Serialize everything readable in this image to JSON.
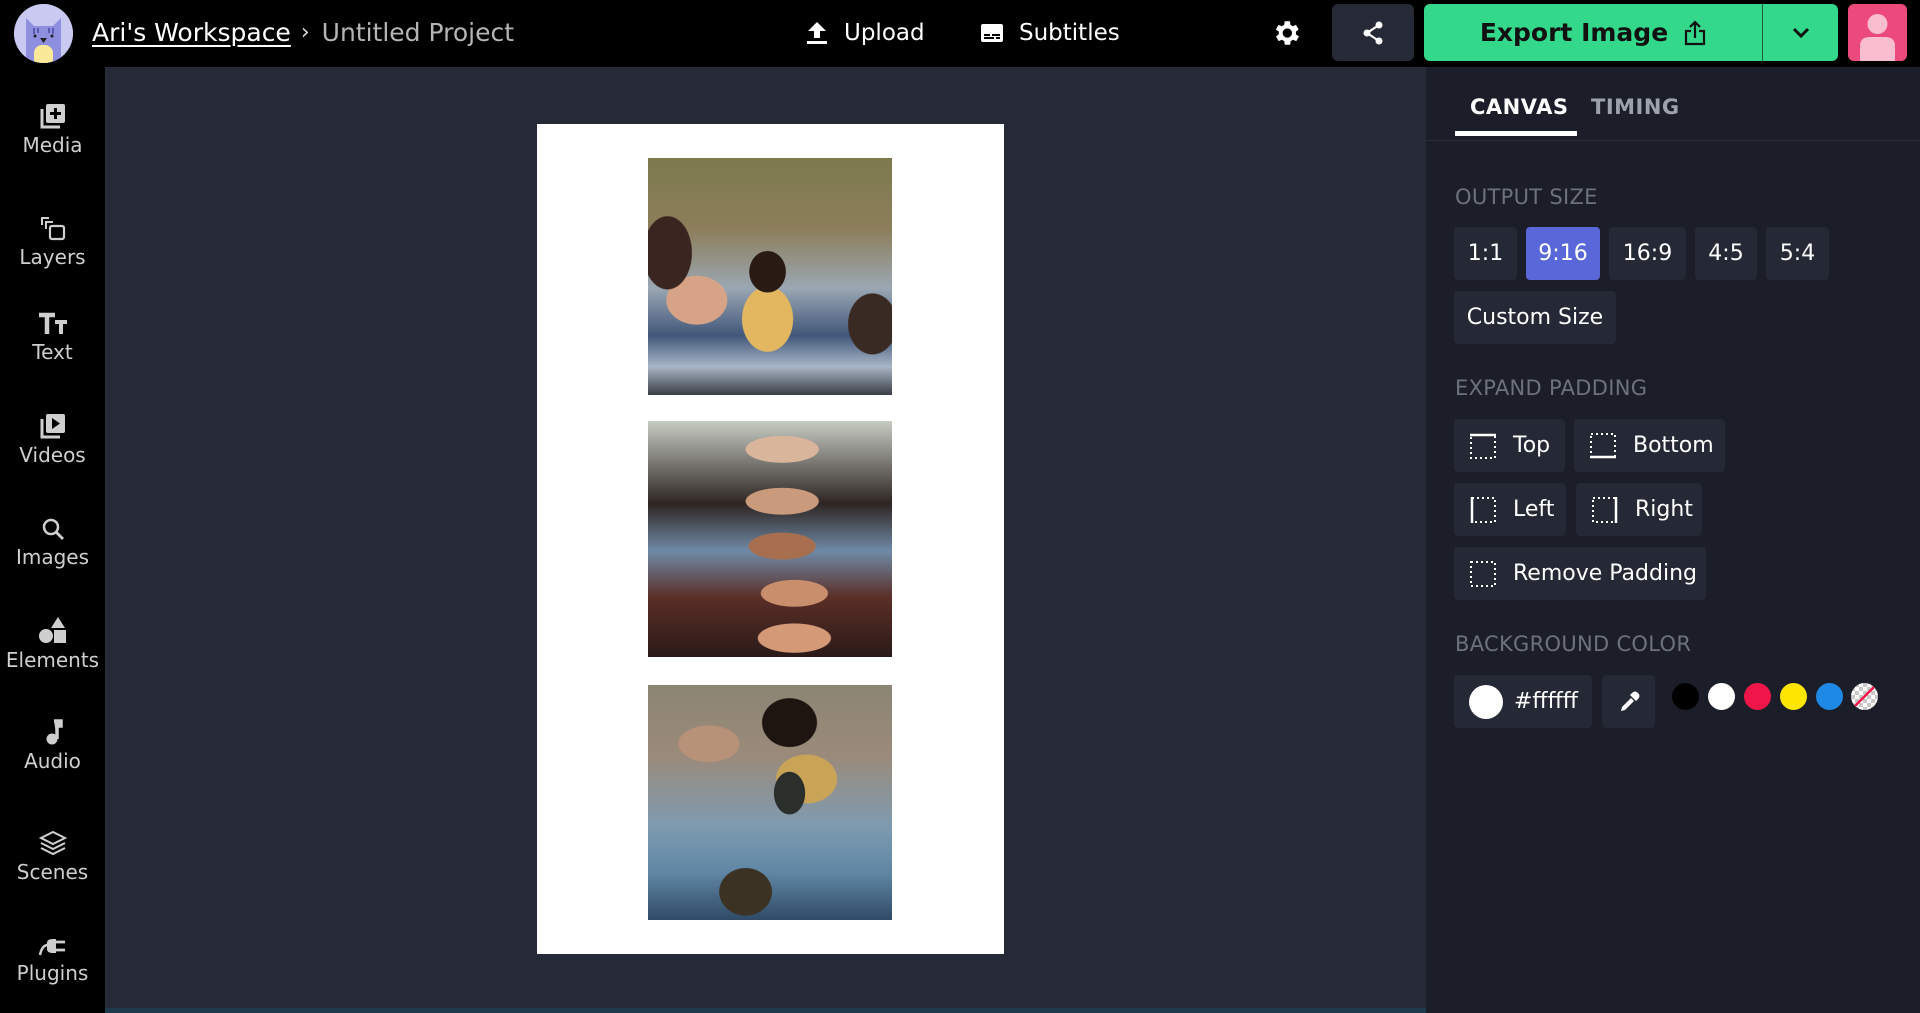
{
  "header": {
    "workspace": "Ari's Workspace",
    "separator": "›",
    "project": "Untitled Project",
    "upload_label": "Upload",
    "subtitles_label": "Subtitles",
    "export_label": "Export Image",
    "colors": {
      "export": "#34d88b",
      "avatar": "#ec4a7c"
    }
  },
  "sidebar": {
    "items": [
      {
        "label": "Media",
        "icon": "media-add-icon"
      },
      {
        "label": "Layers",
        "icon": "layers-icon"
      },
      {
        "label": "Text",
        "icon": "text-icon"
      },
      {
        "label": "Videos",
        "icon": "video-icon"
      },
      {
        "label": "Images",
        "icon": "search-icon"
      },
      {
        "label": "Elements",
        "icon": "shapes-icon"
      },
      {
        "label": "Audio",
        "icon": "music-note-icon"
      },
      {
        "label": "Scenes",
        "icon": "stack-icon"
      },
      {
        "label": "Plugins",
        "icon": "plug-icon"
      }
    ]
  },
  "canvas": {
    "background": "#ffffff",
    "photos": [
      "photo-girl-smiling-picnic",
      "photo-friends-lying-down",
      "photo-girl-with-camcorder"
    ]
  },
  "panel": {
    "tabs": [
      {
        "label": "CANVAS",
        "active": true
      },
      {
        "label": "TIMING",
        "active": false
      }
    ],
    "output_size": {
      "label": "OUTPUT SIZE",
      "options": [
        "1:1",
        "9:16",
        "16:9",
        "4:5",
        "5:4"
      ],
      "selected": "9:16",
      "custom_label": "Custom Size"
    },
    "expand_padding": {
      "label": "EXPAND PADDING",
      "top": "Top",
      "bottom": "Bottom",
      "left": "Left",
      "right": "Right",
      "remove": "Remove Padding"
    },
    "background_color": {
      "label": "BACKGROUND COLOR",
      "value": "#ffffff",
      "swatches": [
        "#000000",
        "#ffffff",
        "#f0164a",
        "#ffe500",
        "#1e88e5",
        "transparent"
      ]
    }
  }
}
